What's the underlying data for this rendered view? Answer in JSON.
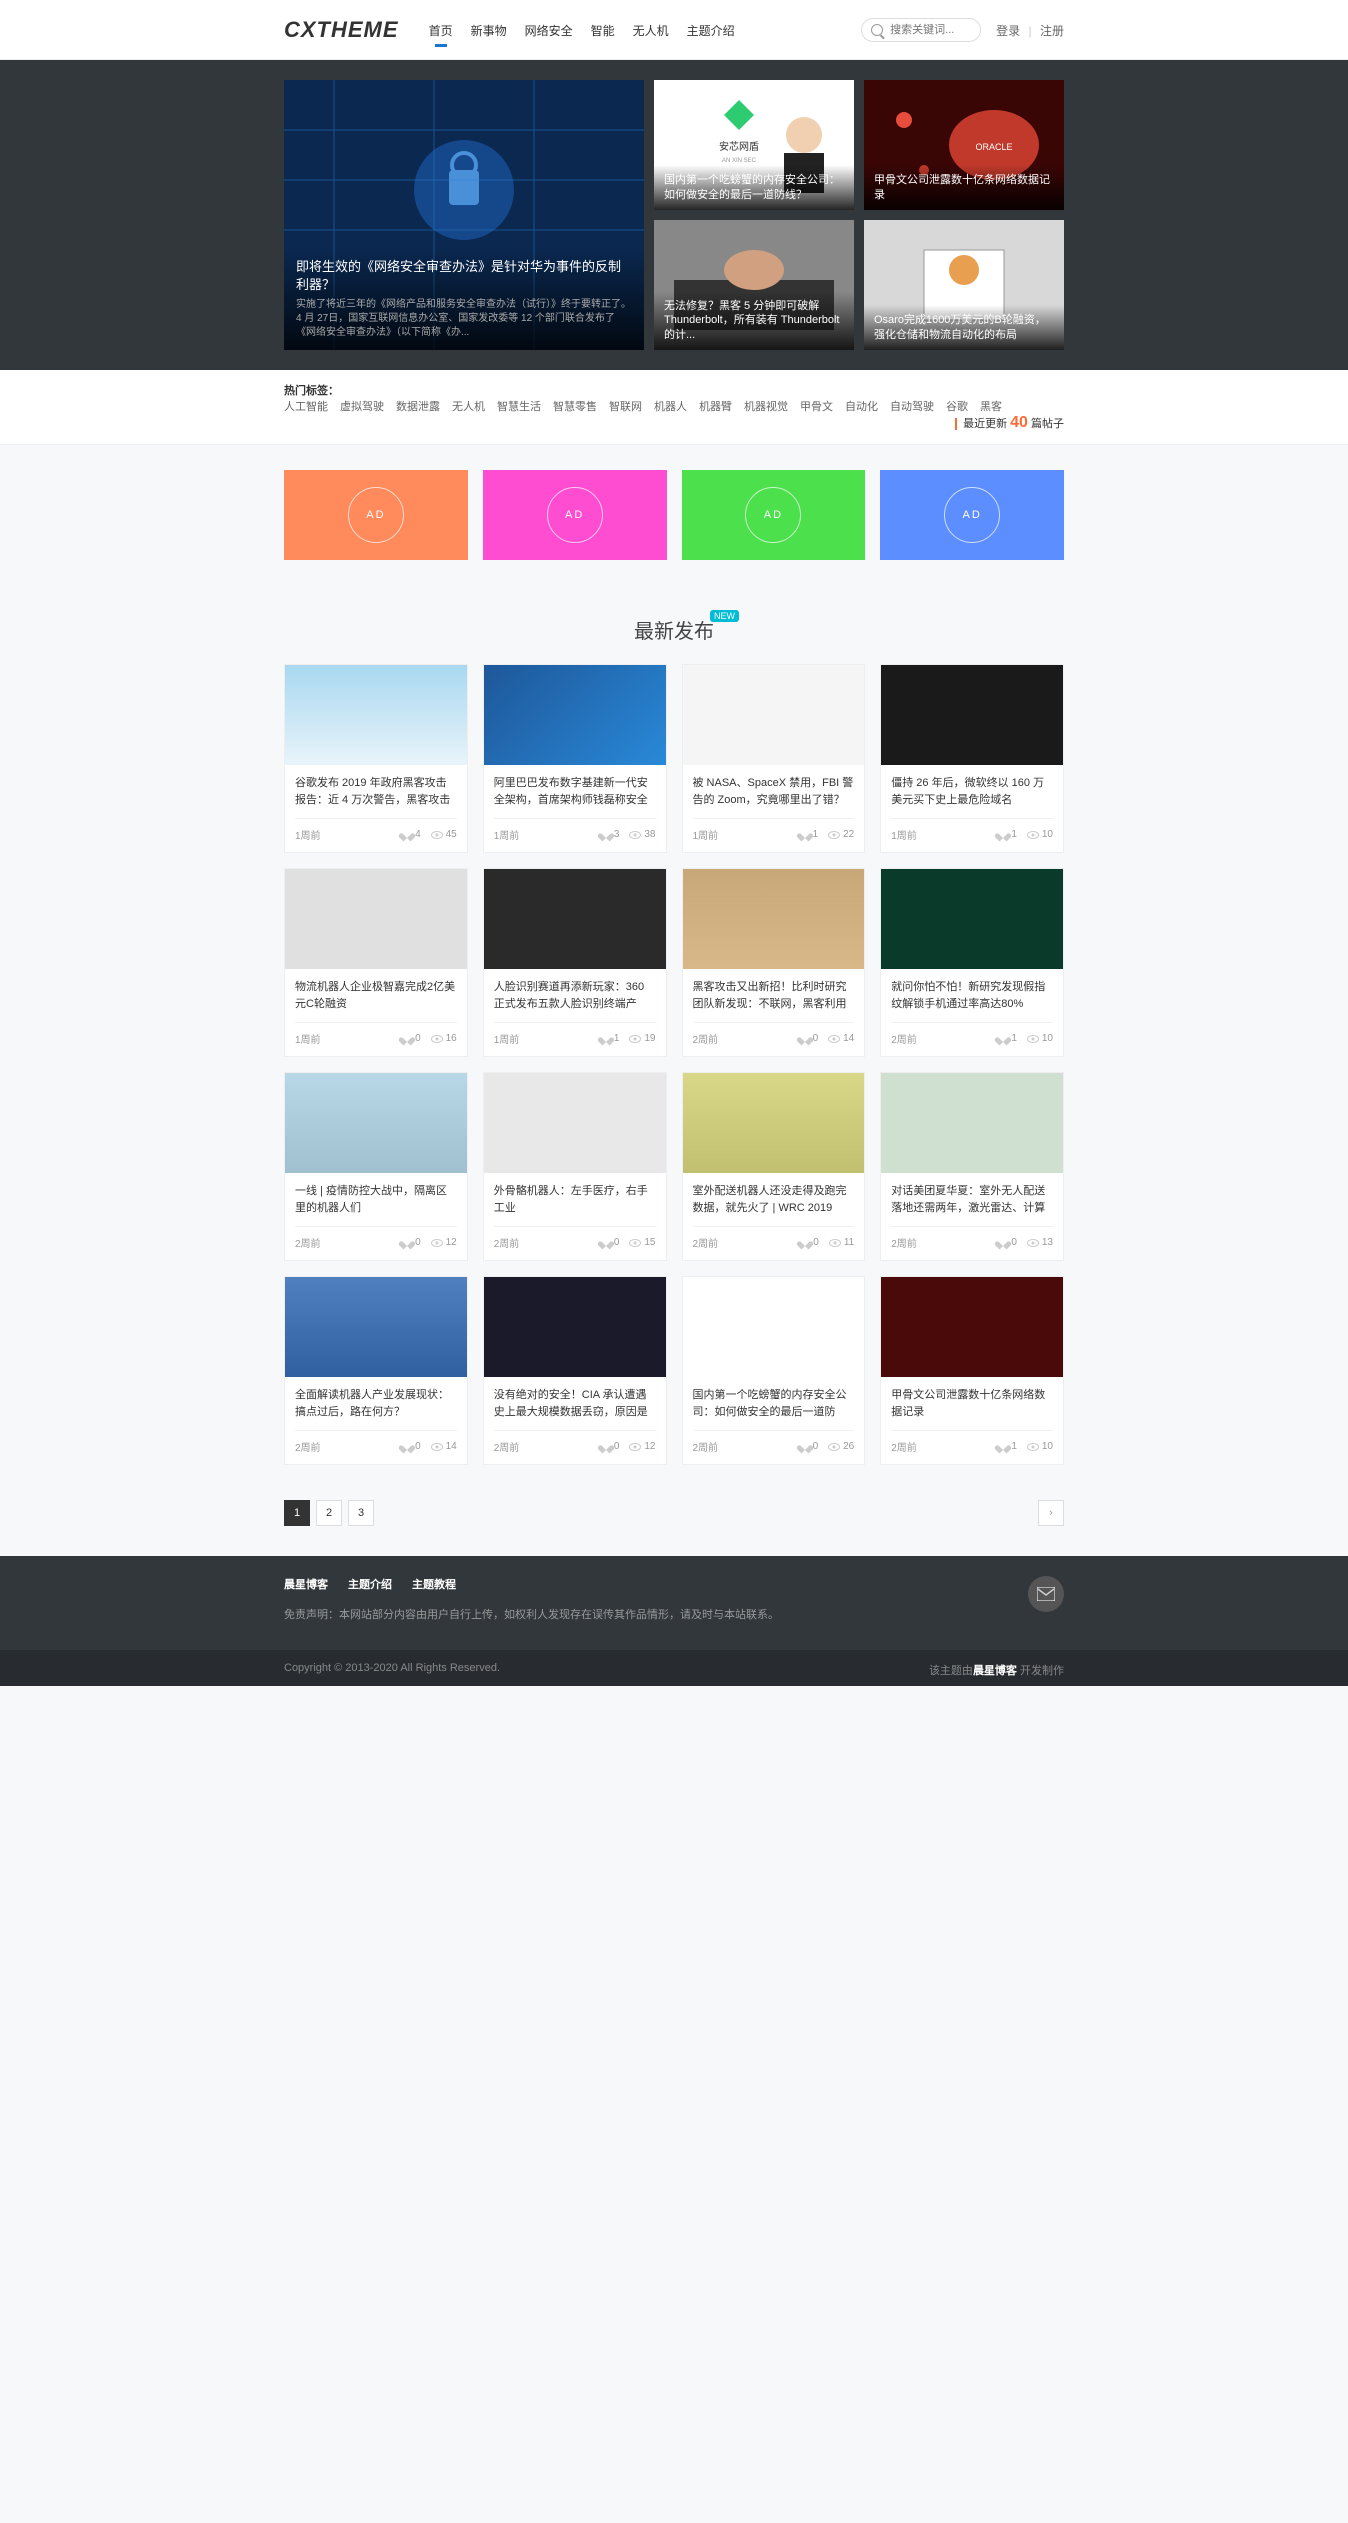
{
  "logo": "CXTHEME",
  "nav": [
    "首页",
    "新事物",
    "网络安全",
    "智能",
    "无人机",
    "主题介绍"
  ],
  "search": {
    "placeholder": "搜索关键词..."
  },
  "auth": {
    "login": "登录",
    "register": "注册"
  },
  "hero": {
    "main": {
      "title": "即将生效的《网络安全审查办法》是针对华为事件的反制利器？",
      "desc": "实施了将近三年的《网络产品和服务安全审查办法（试行）》终于要转正了。4 月 27日，国家互联网信息办公室、国家发改委等 12 个部门联合发布了《网络安全审查办法》（以下简称《办..."
    },
    "items": [
      {
        "title": "国内第一个吃螃蟹的内存安全公司：如何做安全的最后一道防线？"
      },
      {
        "title": "甲骨文公司泄露数十亿条网络数据记录"
      },
      {
        "title": "无法修复？黑客 5 分钟即可破解 Thunderbolt，所有装有 Thunderbolt 的计..."
      },
      {
        "title": "Osaro完成1600万美元的B轮融资，强化仓储和物流自动化的布局"
      }
    ]
  },
  "tags": {
    "label": "热门标签：",
    "items": [
      "人工智能",
      "虚拟驾驶",
      "数据泄露",
      "无人机",
      "智慧生活",
      "智慧零售",
      "智联网",
      "机器人",
      "机器臂",
      "机器视觉",
      "甲骨文",
      "自动化",
      "自动驾驶",
      "谷歌",
      "黑客"
    ],
    "update_pre": "最近更新",
    "update_num": "40",
    "update_suf": "篇帖子"
  },
  "ads": [
    {
      "color": "#ff8a5c",
      "label": "AD"
    },
    {
      "color": "#ff4dd2",
      "label": "AD"
    },
    {
      "color": "#4ce04c",
      "label": "AD"
    },
    {
      "color": "#5c8eff",
      "label": "AD"
    }
  ],
  "section_title": "最新发布",
  "new_badge": "NEW",
  "posts": [
    {
      "th": "th-map",
      "title": "谷歌发布 2019 年政府黑客攻击报告：近 4 万次警告，黑客攻击对象更有针对性",
      "time": "1周前",
      "likes": 4,
      "views": 45
    },
    {
      "th": "th-blue",
      "title": "阿里巴巴发布数字基建新一代安全架构，首席架构师钱磊称安全基建将成数字经济标配",
      "time": "1周前",
      "likes": 3,
      "views": 38
    },
    {
      "th": "th-chart",
      "title": "被 NASA、SpaceX 禁用，FBI 警告的 Zoom，究竟哪里出了错？",
      "time": "1周前",
      "likes": 1,
      "views": 22
    },
    {
      "th": "th-dark",
      "title": "僵持 26 年后，微软终以 160 万美元买下史上最危险域名",
      "time": "1周前",
      "likes": 1,
      "views": 10
    },
    {
      "th": "th-gray",
      "title": "物流机器人企业极智嘉完成2亿美元C轮融资",
      "time": "1周前",
      "likes": 0,
      "views": 16
    },
    {
      "th": "th-360",
      "title": "人脸识别赛道再添新玩家：360 正式发布五款人脸识别终端产品，主打安全牌",
      "time": "1周前",
      "likes": 1,
      "views": 19
    },
    {
      "th": "th-pc",
      "title": "黑客攻击又出新招！比利时研究团队新发现：不联网，黑客利用风扇也能窃取你的...",
      "time": "2周前",
      "likes": 0,
      "views": 14
    },
    {
      "th": "th-code",
      "title": "就问你怕不怕！新研究发现假指纹解锁手机通过率高达80%",
      "time": "2周前",
      "likes": 1,
      "views": 10
    },
    {
      "th": "th-room",
      "title": "一线 | 疫情防控大战中，隔离区里的机器人们",
      "time": "2周前",
      "likes": 0,
      "views": 12
    },
    {
      "th": "th-suit",
      "title": "外骨骼机器人：左手医疗，右手工业",
      "time": "2周前",
      "likes": 0,
      "views": 15
    },
    {
      "th": "th-yellow",
      "title": "室外配送机器人还没走得及跑完数据，就先火了 | WRC 2019",
      "time": "2周前",
      "likes": 0,
      "views": 11
    },
    {
      "th": "th-drone",
      "title": "对话美团夏华夏：室外无人配送落地还需两年，激光雷达、计算芯片成关键瓶颈",
      "time": "2周前",
      "likes": 0,
      "views": 13
    },
    {
      "th": "th-conf",
      "title": "全面解读机器人产业发展现状：搞点过后，路在何方？",
      "time": "2周前",
      "likes": 0,
      "views": 14
    },
    {
      "th": "th-vault",
      "title": "没有绝对的安全！CIA 承认遭遇史上最大规模数据丢窃，原因是自家后院着了火",
      "time": "2周前",
      "likes": 0,
      "views": 12
    },
    {
      "th": "th-anxin",
      "title": "国内第一个吃螃蟹的内存安全公司：如何做安全的最后一道防线？",
      "time": "2周前",
      "likes": 0,
      "views": 26
    },
    {
      "th": "th-oracle",
      "title": "甲骨文公司泄露数十亿条网络数据记录",
      "time": "2周前",
      "likes": 1,
      "views": 10
    }
  ],
  "pagination": [
    "1",
    "2",
    "3"
  ],
  "footer": {
    "nav": [
      "晨星博客",
      "主题介绍",
      "主题教程"
    ],
    "disclaimer": "免责声明：本网站部分内容由用户自行上传，如权利人发现存在误传其作品情形，请及时与本站联系。",
    "copyright": "Copyright © 2013-2020 All Rights Reserved.",
    "credit_pre": "该主题由",
    "credit_name": "晨星博客",
    "credit_suf": " 开发制作"
  }
}
